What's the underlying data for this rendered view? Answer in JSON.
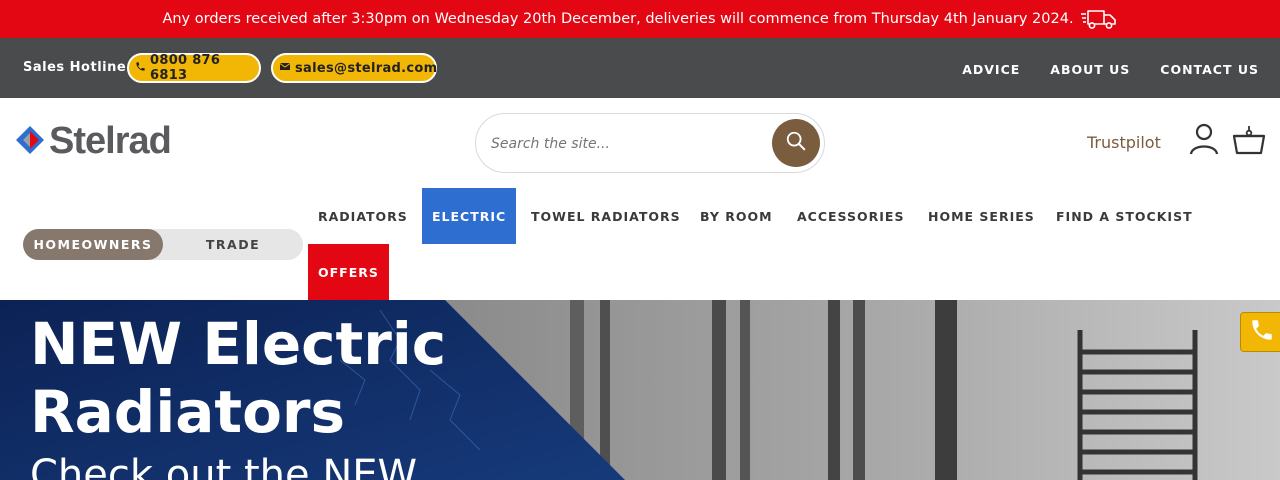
{
  "announcement": {
    "text": "Any orders received after 3:30pm on Wednesday 20th December, deliveries will commence from Thursday 4th January 2024."
  },
  "topbar": {
    "hotline_label": "Sales Hotline:",
    "phone": "0800 876 6813",
    "email": "sales@stelrad.com",
    "links": [
      "ADVICE",
      "ABOUT US",
      "CONTACT US"
    ]
  },
  "header": {
    "logo_text": "Stelrad",
    "search_placeholder": "Search the site...",
    "trustpilot": "Trustpilot"
  },
  "audience_toggle": {
    "homeowners": "HOMEOWNERS",
    "trade": "TRADE"
  },
  "nav": {
    "items": [
      "RADIATORS",
      "ELECTRIC",
      "TOWEL RADIATORS",
      "BY ROOM",
      "ACCESSORIES",
      "HOME SERIES",
      "FIND A STOCKIST"
    ],
    "offers": "OFFERS",
    "active": "ELECTRIC"
  },
  "hero": {
    "title_line1": "NEW Electric",
    "title_line2": "Radiators",
    "subtitle": "Check out the NEW"
  },
  "colors": {
    "brand_red": "#e30613",
    "topbar_grey": "#4a4b4c",
    "accent_yellow": "#f2b705",
    "brand_brown": "#7a5c3e",
    "nav_active_blue": "#2d6ed0",
    "hero_navy": "#0f2a5c"
  },
  "icons": [
    "truck-icon",
    "phone-icon",
    "mail-icon",
    "search-icon",
    "account-icon",
    "basket-icon",
    "stelrad-logo-icon"
  ]
}
